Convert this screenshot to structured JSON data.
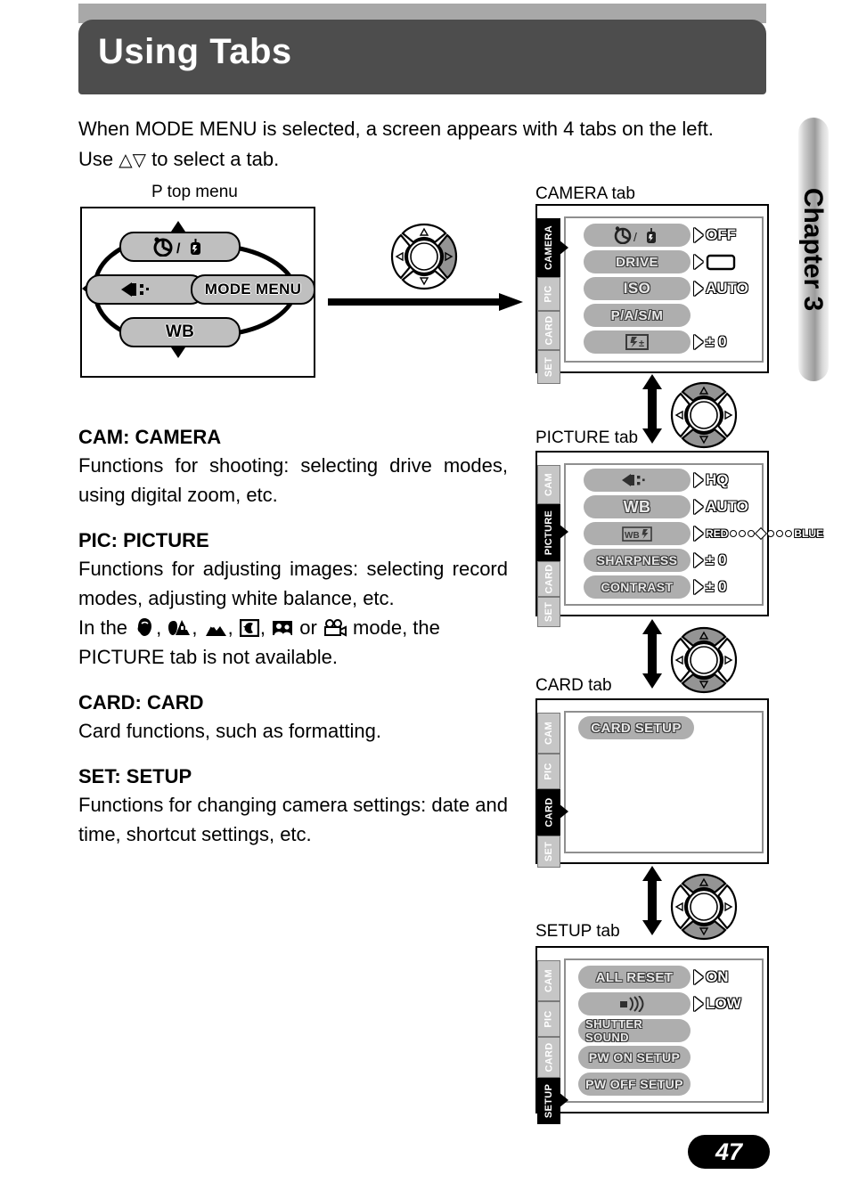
{
  "header": {
    "title": "Using Tabs"
  },
  "chapter": {
    "label": "Chapter 3"
  },
  "page": {
    "number": "47"
  },
  "intro": {
    "line1": "When MODE MENU is selected, a screen appears with 4 tabs on the left.",
    "line2_pre": "Use",
    "line2_post": "to select a tab.",
    "up_arrow": "△",
    "down_arrow": "▽"
  },
  "figures": {
    "top_menu_caption": "P top menu",
    "camera_tab_caption": "CAMERA tab",
    "picture_tab_caption": "PICTURE tab",
    "card_tab_caption": "CARD tab",
    "setup_tab_caption": "SETUP tab"
  },
  "top_menu": {
    "top_label": "selftimer-flash-icon",
    "left_label": "drive-quality-icon",
    "right_label": "MODE MENU",
    "bottom_label": "WB"
  },
  "sections": [
    {
      "heading": "CAM: CAMERA",
      "body": "Functions for shooting: selecting drive modes, using digital zoom, etc."
    },
    {
      "heading": "PIC: PICTURE",
      "body": "Functions for adjusting images: selecting record modes, adjusting white balance, etc.",
      "body2_pre": "In the",
      "body2_mid": "or",
      "body2_post": "mode, the PICTURE tab is not available.",
      "mode_icons": [
        "portrait-icon",
        "portrait-landscape-icon",
        "landscape-icon",
        "night-scene-icon",
        "self-portrait-icon",
        "movie-icon"
      ]
    },
    {
      "heading": "CARD: CARD",
      "body": "Card functions, such as formatting."
    },
    {
      "heading": "SET: SETUP",
      "body": "Functions for changing camera settings: date and time, shortcut settings, etc."
    }
  ],
  "screens": [
    {
      "id": "camera",
      "tabs": [
        "CAMERA",
        "PIC",
        "CARD",
        "SET"
      ],
      "active_tab": "CAMERA",
      "rows": [
        {
          "label": "selftimer-flash-icon",
          "label_kind": "icon",
          "value": "OFF"
        },
        {
          "label": "DRIVE",
          "label_kind": "text",
          "value": "single-frame-icon",
          "value_kind": "icon"
        },
        {
          "label": "ISO",
          "label_kind": "text",
          "value": "AUTO"
        },
        {
          "label": "P/A/S/M",
          "label_kind": "text",
          "value": ""
        },
        {
          "label": "flash-compensation-icon",
          "label_kind": "icon",
          "value": "± 0"
        }
      ]
    },
    {
      "id": "picture",
      "tabs": [
        "CAM",
        "PICTURE",
        "CARD",
        "SET"
      ],
      "active_tab": "PICTURE",
      "rows": [
        {
          "label": "record-mode-icon",
          "label_kind": "icon",
          "value": "HQ"
        },
        {
          "label": "WB",
          "label_kind": "text",
          "value": "AUTO"
        },
        {
          "label": "wb-adjust-icon",
          "label_kind": "icon",
          "value_kind": "wbbar",
          "value_left": "RED",
          "value_right": "BLUE"
        },
        {
          "label": "SHARPNESS",
          "label_kind": "text",
          "value": "± 0"
        },
        {
          "label": "CONTRAST",
          "label_kind": "text",
          "value": "± 0"
        }
      ]
    },
    {
      "id": "card",
      "tabs": [
        "CAM",
        "PIC",
        "CARD",
        "SET"
      ],
      "active_tab": "CARD",
      "rows": [
        {
          "label": "CARD SETUP",
          "label_kind": "text",
          "value": ""
        }
      ]
    },
    {
      "id": "setup",
      "tabs": [
        "CAM",
        "PIC",
        "CARD",
        "SETUP"
      ],
      "active_tab": "SETUP",
      "rows": [
        {
          "label": "ALL RESET",
          "label_kind": "text",
          "value": "ON"
        },
        {
          "label": "beep-volume-icon",
          "label_kind": "icon",
          "value": "LOW"
        },
        {
          "label": "SHUTTER SOUND",
          "label_kind": "text",
          "value": ""
        },
        {
          "label": "PW ON SETUP",
          "label_kind": "text",
          "value": ""
        },
        {
          "label": "PW OFF SETUP",
          "label_kind": "text",
          "value": ""
        }
      ]
    }
  ],
  "colors": {
    "header_bg": "#4d4d4d",
    "header_rule": "#a8a8a8",
    "pill_grey": "#bfbfbf",
    "menu_pill": "#aeaeae",
    "tab_inactive": "#c6c6c6",
    "tab_active": "#000000"
  }
}
